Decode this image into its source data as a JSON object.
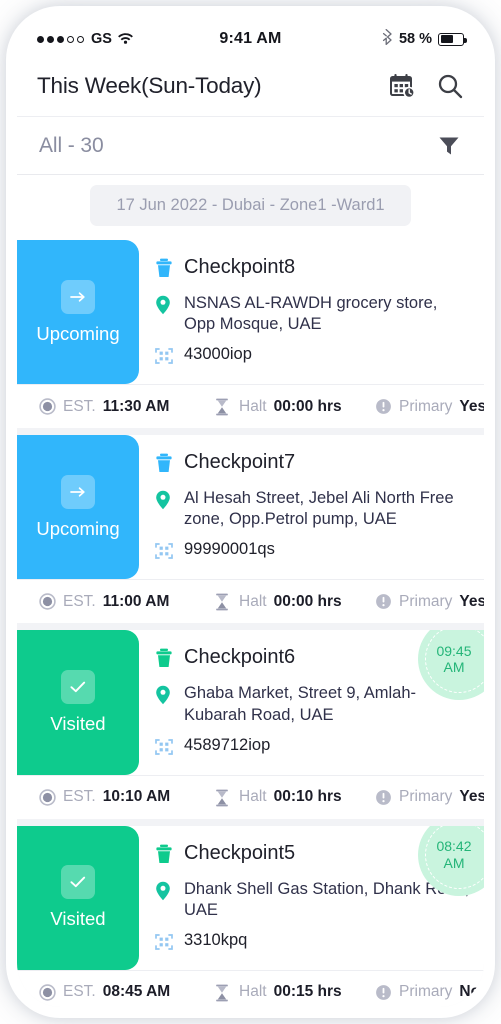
{
  "status_bar": {
    "signal_dots_filled": 3,
    "signal_dots_total": 5,
    "carrier": "GS",
    "wifi_icon": "wifi-icon",
    "time": "9:41 AM",
    "bluetooth_icon": "bluetooth-icon",
    "battery_percent_label": "58 %",
    "battery_level": 58
  },
  "header": {
    "title": "This Week(Sun-Today)",
    "calendar_icon": "calendar-clock-icon",
    "search_icon": "search-icon"
  },
  "filter": {
    "value": "All - 30",
    "filter_icon": "funnel-icon"
  },
  "date_group": {
    "label": "17 Jun 2022 - Dubai - Zone1 -Ward1"
  },
  "colors": {
    "upcoming": "#31b6fb",
    "visited": "#0ecb8d",
    "badge_bg": "#c9f4de",
    "badge_text": "#24b578",
    "bin_icon_upcoming": "#31b6fb",
    "bin_icon_visited": "#0ecb8d",
    "pin_icon": "#14c4a0",
    "qr_icon": "#93c7f2"
  },
  "meta_labels": {
    "est": "EST.",
    "halt": "Halt",
    "primary": "Primary",
    "est_icon": "clock-icon",
    "halt_icon": "hourglass-icon",
    "primary_icon": "info-icon"
  },
  "checkpoints": [
    {
      "status": "Upcoming",
      "status_kind": "upcoming",
      "status_icon": "arrow-right-icon",
      "name": "Checkpoint8",
      "address": "NSNAS AL-RAWDH grocery store, Opp Mosque, UAE",
      "code": "43000iop",
      "est": "11:30 AM",
      "halt": "00:00 hrs",
      "primary": "Yes",
      "time_badge": null
    },
    {
      "status": "Upcoming",
      "status_kind": "upcoming",
      "status_icon": "arrow-right-icon",
      "name": "Checkpoint7",
      "address": "Al Hesah Street, Jebel Ali North Free zone,  Opp.Petrol pump, UAE",
      "code": "99990001qs",
      "est": "11:00 AM",
      "halt": "00:00 hrs",
      "primary": "Yes",
      "time_badge": null
    },
    {
      "status": "Visited",
      "status_kind": "visited",
      "status_icon": "check-icon",
      "name": "Checkpoint6",
      "address": "Ghaba Market, Street 9, Amlah-Kubarah Road, UAE",
      "code": "4589712iop",
      "est": "10:10 AM",
      "halt": "00:10 hrs",
      "primary": "Yes",
      "time_badge": "09:45\nAM"
    },
    {
      "status": "Visited",
      "status_kind": "visited",
      "status_icon": "check-icon",
      "name": "Checkpoint5",
      "address": "Dhank Shell Gas Station, Dhank Road, UAE",
      "code": "3310kpq",
      "est": "08:45 AM",
      "halt": "00:15 hrs",
      "primary": "No",
      "time_badge": "08:42\nAM"
    }
  ]
}
